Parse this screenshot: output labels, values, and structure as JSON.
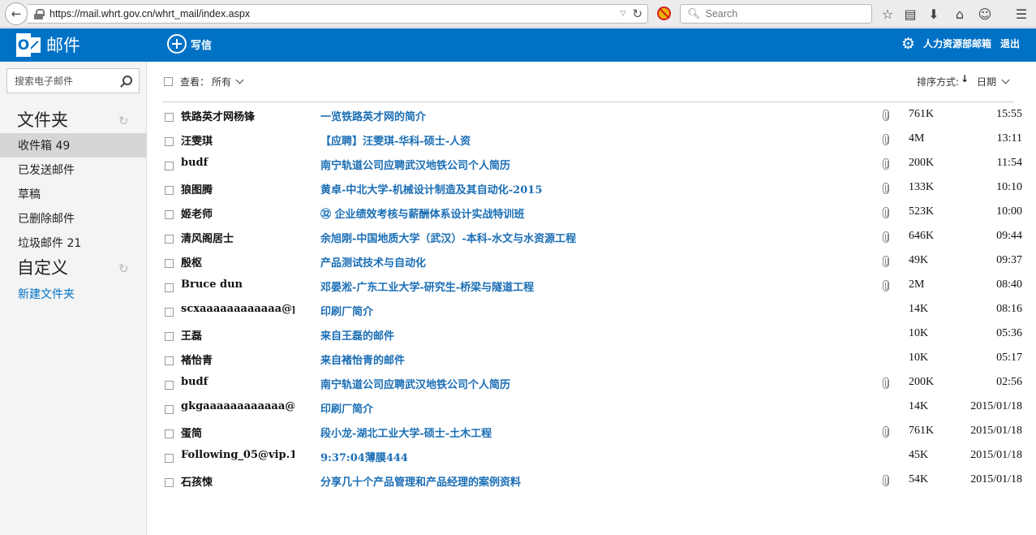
{
  "browser": {
    "url": "https://mail.whrt.gov.cn/whrt_mail/index.aspx",
    "search_placeholder": "Search"
  },
  "header": {
    "app_title": "邮件",
    "compose_label": "写信",
    "user_name": "人力资源部邮箱",
    "logout_label": "退出",
    "brand_color": "#0072c6"
  },
  "sidebar": {
    "search_placeholder": "搜索电子邮件",
    "folders_heading": "文件夹",
    "folders": [
      {
        "label": "收件箱 49",
        "selected": true
      },
      {
        "label": "已发送邮件",
        "selected": false
      },
      {
        "label": "草稿",
        "selected": false
      },
      {
        "label": "已删除邮件",
        "selected": false
      },
      {
        "label": "垃圾邮件 21",
        "selected": false
      }
    ],
    "custom_heading": "自定义",
    "new_folder_label": "新建文件夹"
  },
  "list": {
    "filter_label": "查看：",
    "filter_value": "所有",
    "sort_label": "排序方式:",
    "sort_direction": "↓",
    "sort_value": "日期",
    "messages": [
      {
        "sender": "铁路英才网杨锋",
        "subject": "一览铁路英才网的简介",
        "attachment": true,
        "size": "761K",
        "time": "15:55"
      },
      {
        "sender": "汪雯琪",
        "subject": "【应聘】汪雯琪-华科-硕士-人资",
        "attachment": true,
        "size": "4M",
        "time": "13:11"
      },
      {
        "sender": "budf",
        "subject": "南宁轨道公司应聘武汉地铁公司个人简历",
        "attachment": true,
        "size": "200K",
        "time": "11:54"
      },
      {
        "sender": "狼图腾",
        "subject": "黄卓-中北大学-机械设计制造及其自动化-2015",
        "attachment": true,
        "size": "133K",
        "time": "10:10"
      },
      {
        "sender": "姬老师",
        "subject": "㉜ 企业绩效考核与薪酬体系设计实战特训班",
        "attachment": true,
        "size": "523K",
        "time": "10:00"
      },
      {
        "sender": "清风阁居士",
        "subject": "余旭刚-中国地质大学（武汉）-本科-水文与水资源工程",
        "attachment": true,
        "size": "646K",
        "time": "09:44"
      },
      {
        "sender": "殷枢",
        "subject": "产品测试技术与自动化",
        "attachment": true,
        "size": "49K",
        "time": "09:37"
      },
      {
        "sender": "Bruce dun",
        "subject": "邓晏淞-广东工业大学-研究生-桥梁与隧道工程",
        "attachment": true,
        "size": "2M",
        "time": "08:40"
      },
      {
        "sender": "scxaaaaaaaaaaaa@p…",
        "subject": "印刷厂简介",
        "attachment": false,
        "size": "14K",
        "time": "08:16"
      },
      {
        "sender": "王磊",
        "subject": "来自王磊的邮件",
        "attachment": false,
        "size": "10K",
        "time": "05:36"
      },
      {
        "sender": "褚怡青",
        "subject": "来自褚怡青的邮件",
        "attachment": false,
        "size": "10K",
        "time": "05:17"
      },
      {
        "sender": "budf",
        "subject": "南宁轨道公司应聘武汉地铁公司个人简历",
        "attachment": true,
        "size": "200K",
        "time": "02:56"
      },
      {
        "sender": "gkgaaaaaaaaaaaa@…",
        "subject": "印刷厂简介",
        "attachment": false,
        "size": "14K",
        "time": "2015/01/18"
      },
      {
        "sender": "蛋简",
        "subject": "段小龙-湖北工业大学-硕士-土木工程",
        "attachment": true,
        "size": "761K",
        "time": "2015/01/18"
      },
      {
        "sender": "Following_05@vip.1…",
        "subject": "9:37:04薄膜444",
        "attachment": false,
        "size": "45K",
        "time": "2015/01/18"
      },
      {
        "sender": "石孩悚",
        "subject": "分享几十个产品管理和产品经理的案例资料",
        "attachment": true,
        "size": "54K",
        "time": "2015/01/18"
      }
    ]
  }
}
